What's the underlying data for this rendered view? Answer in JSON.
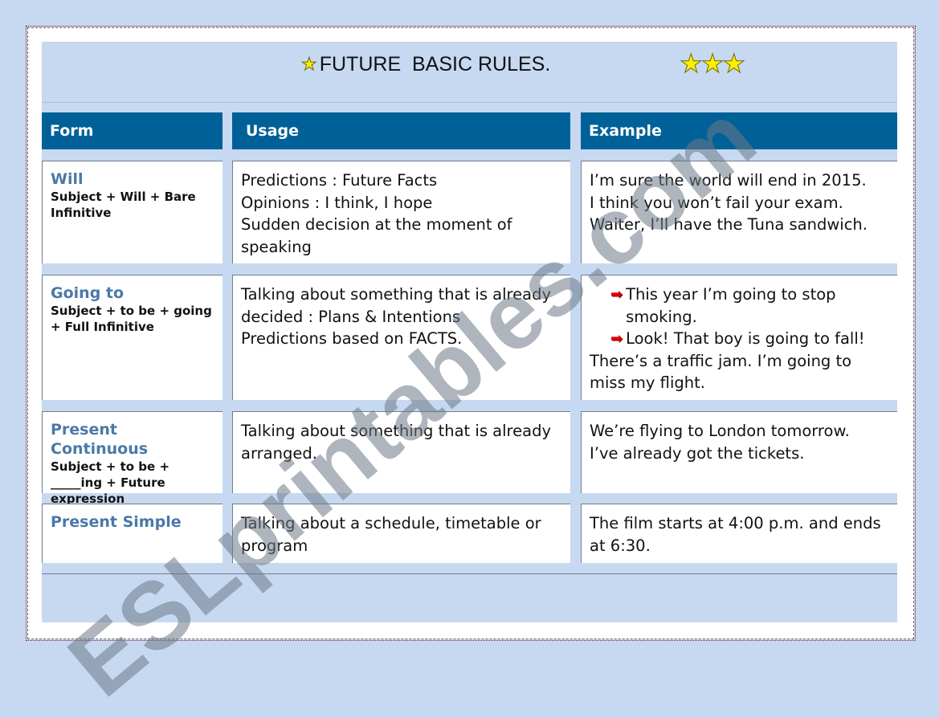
{
  "title": "FUTURE  BASIC RULES.",
  "stars_count": 3,
  "headers": [
    "Form",
    "Usage",
    "Example"
  ],
  "rows": [
    {
      "form": "Will",
      "rule": "Subject + Will + Bare Infinitive",
      "usage": [
        "Predictions : Future Facts",
        "Opinions : I think, I hope",
        "Sudden decision at the moment of speaking"
      ],
      "examples": [
        {
          "text": "I’m sure the world will end in 2015.",
          "bullet": false
        },
        {
          "text": "I think you won’t fail your exam.",
          "bullet": false
        },
        {
          "text": "Waiter, I’ll have the Tuna sandwich.",
          "bullet": false
        }
      ]
    },
    {
      "form": "Going to",
      "rule": "Subject + to be + going  + Full Infinitive",
      "usage": [
        "Talking about something that is already decided : Plans & Intentions",
        "Predictions based on FACTS."
      ],
      "examples": [
        {
          "text": "This year I’m going to stop smoking.",
          "bullet": true
        },
        {
          "text": "Look! That boy is going to fall!",
          "bullet": true
        },
        {
          "text": "There’s a traffic jam. I’m going to miss my flight.",
          "bullet": false
        }
      ]
    },
    {
      "form": "Present Continuous",
      "rule": "Subject + to be + _____ing + Future expression",
      "usage": [
        "Talking about something that is already arranged."
      ],
      "examples": [
        {
          "text": "We’re flying to London tomorrow.",
          "bullet": false
        },
        {
          "text": "I’ve already got the tickets.",
          "bullet": false
        }
      ]
    },
    {
      "form": "Present Simple",
      "rule": "",
      "usage": [
        "Talking about a schedule, timetable or program"
      ],
      "examples": [
        {
          "text": "The film starts at 4:00 p.m. and ends at 6:30.",
          "bullet": false
        }
      ]
    }
  ],
  "watermark": "ESLprintables.com",
  "colors": {
    "header_bg": "#006198",
    "page_bg": "#c6d9f1",
    "form_title": "#4a79a8",
    "bullet_arrow": "#e00000",
    "star": "#ffee00"
  }
}
